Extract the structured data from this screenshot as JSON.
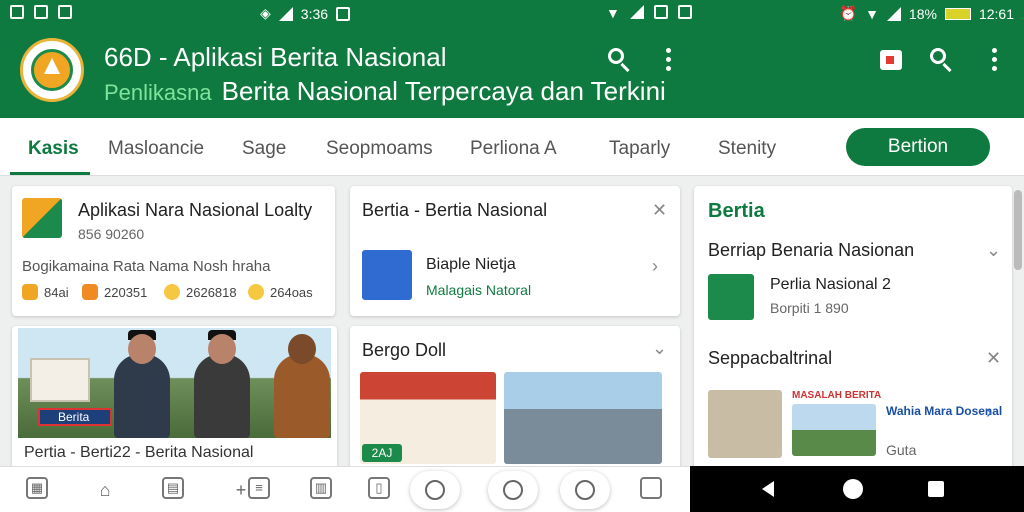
{
  "status": {
    "left_time": "3:36",
    "right_battery": "18%",
    "right_time": "12:61",
    "left_icons": [
      "sim-icon",
      "gallery-icon",
      "image-icon"
    ]
  },
  "appbar": {
    "title": "66D - Aplikasi Berita Nasional",
    "subtitle_prefix": "Penlikasna",
    "subtitle": "Berita Nasional Terpercaya dan Terkini",
    "color": "#0f7a3f"
  },
  "tabs": {
    "items": [
      "Kasis",
      "Masloancie",
      "Sage",
      "Seopmoams",
      "Perliona A",
      "Taparly",
      "Stenity"
    ],
    "active_index": 0,
    "button_label": "Bertion"
  },
  "card1": {
    "title": "Aplikasi Nara Nasional Loalty",
    "meta": "856 90260",
    "desc": "Bogikamaina Rata Nama Nosh hraha",
    "stats": [
      "84ai",
      "220351",
      "2626818",
      "264oas"
    ]
  },
  "card2": {
    "tag": "Berita",
    "caption": "Pertia - Berti22 - Berita Nasional"
  },
  "card3": {
    "title": "Bertia - Bertia Nasional",
    "item_title": "Biaple Nietja",
    "item_meta": "Malagais Natoral"
  },
  "card4": {
    "title": "Bergo Doll",
    "tag": "2AJ"
  },
  "card5": {
    "heading": "Bertia",
    "section1": "Berriap Benaria Nasionan",
    "item1_title": "Perlia Nasional 2",
    "item1_meta": "Borpiti 1 890",
    "section2": "Seppacbaltrinal",
    "item2_tag": "MASALAH BERITA",
    "item2_title": "Wahia Mara Dosenal",
    "item2_meta": "Guta"
  }
}
